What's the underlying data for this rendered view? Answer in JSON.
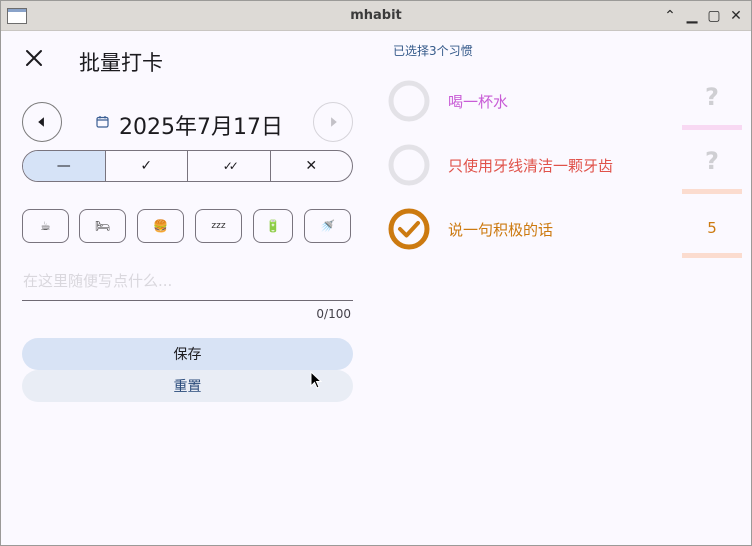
{
  "window": {
    "title": "mhabit"
  },
  "header": {
    "title": "批量打卡"
  },
  "date": {
    "value": "2025年7月17日"
  },
  "segments": [
    {
      "label": "—",
      "icon": "dash-icon",
      "selected": true
    },
    {
      "label": "✓",
      "icon": "check-icon",
      "selected": false
    },
    {
      "label": "✓✓",
      "icon": "double-check-icon",
      "selected": false
    },
    {
      "label": "✕",
      "icon": "cross-icon",
      "selected": false
    }
  ],
  "chips": [
    {
      "icon": "coffee-icon",
      "glyph": "☕"
    },
    {
      "icon": "bed-icon",
      "glyph": "🛏"
    },
    {
      "icon": "burger-icon",
      "glyph": "🍔"
    },
    {
      "icon": "sleep-icon",
      "glyph": "zzz"
    },
    {
      "icon": "battery-icon",
      "glyph": "🔋"
    },
    {
      "icon": "shower-icon",
      "glyph": "🚿"
    }
  ],
  "note": {
    "placeholder": "在这里随便写点什么...",
    "counter": "0/100"
  },
  "buttons": {
    "save": "保存",
    "reset": "重置"
  },
  "selected_count": "已选择3个习惯",
  "habits": [
    {
      "name": "喝一杯水",
      "value": "?",
      "color": "#c85bd6",
      "bar_color": "#f8d9f3",
      "completed": false
    },
    {
      "name": "只使用牙线清洁一颗牙齿",
      "value": "?",
      "color": "#e0524a",
      "bar_color": "#fbdccf",
      "completed": false
    },
    {
      "name": "说一句积极的话",
      "value": "5",
      "color": "#cc7a10",
      "bar_color": "#fbdccf",
      "completed": true
    }
  ]
}
